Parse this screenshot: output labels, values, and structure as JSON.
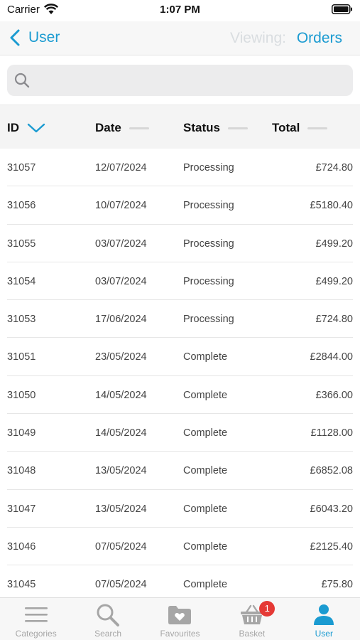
{
  "status_bar": {
    "carrier": "Carrier",
    "time": "1:07 PM"
  },
  "nav": {
    "back_label": "User",
    "viewing_label": "Viewing:",
    "orders_label": "Orders"
  },
  "search": {
    "placeholder": "",
    "value": ""
  },
  "table": {
    "headers": {
      "id": "ID",
      "date": "Date",
      "status": "Status",
      "total": "Total"
    },
    "sort_column": "ID",
    "rows": [
      {
        "id": "31057",
        "date": "12/07/2024",
        "status": "Processing",
        "total": "£724.80"
      },
      {
        "id": "31056",
        "date": "10/07/2024",
        "status": "Processing",
        "total": "£5180.40"
      },
      {
        "id": "31055",
        "date": "03/07/2024",
        "status": "Processing",
        "total": "£499.20"
      },
      {
        "id": "31054",
        "date": "03/07/2024",
        "status": "Processing",
        "total": "£499.20"
      },
      {
        "id": "31053",
        "date": "17/06/2024",
        "status": "Processing",
        "total": "£724.80"
      },
      {
        "id": "31051",
        "date": "23/05/2024",
        "status": "Complete",
        "total": "£2844.00"
      },
      {
        "id": "31050",
        "date": "14/05/2024",
        "status": "Complete",
        "total": "£366.00"
      },
      {
        "id": "31049",
        "date": "14/05/2024",
        "status": "Complete",
        "total": "£1128.00"
      },
      {
        "id": "31048",
        "date": "13/05/2024",
        "status": "Complete",
        "total": "£6852.08"
      },
      {
        "id": "31047",
        "date": "13/05/2024",
        "status": "Complete",
        "total": "£6043.20"
      },
      {
        "id": "31046",
        "date": "07/05/2024",
        "status": "Complete",
        "total": "£2125.40"
      },
      {
        "id": "31045",
        "date": "07/05/2024",
        "status": "Complete",
        "total": "£75.80"
      }
    ]
  },
  "tabs": [
    {
      "label": "Categories",
      "icon": "menu-lines-icon"
    },
    {
      "label": "Search",
      "icon": "magnifier-icon"
    },
    {
      "label": "Favourites",
      "icon": "heart-folder-icon"
    },
    {
      "label": "Basket",
      "icon": "basket-icon",
      "badge": "1"
    },
    {
      "label": "User",
      "icon": "user-icon",
      "active": true
    }
  ],
  "colors": {
    "accent": "#1b9bd1",
    "badge": "#e53935",
    "inactive_tab": "#a6a6a6"
  }
}
